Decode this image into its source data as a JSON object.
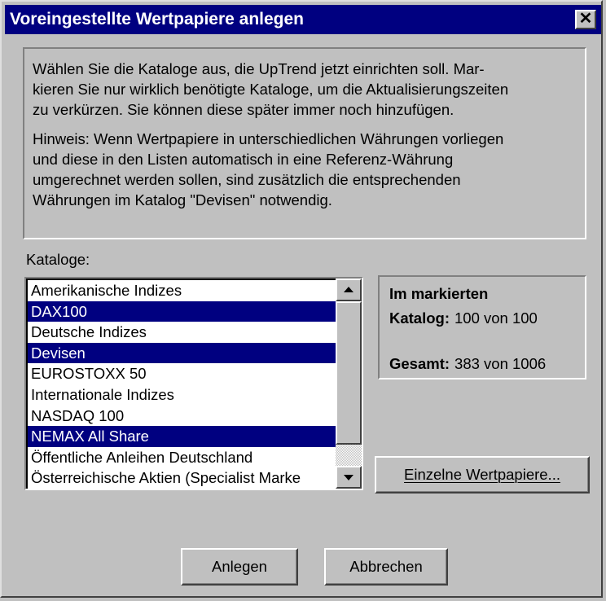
{
  "window": {
    "title": "Voreingestellte Wertpapiere anlegen",
    "close_glyph": "✕"
  },
  "info": {
    "paragraph1": "Wählen Sie die Kataloge aus, die UpTrend jetzt einrichten soll. Markieren Sie nur wirklich benötigte Kataloge, um die Aktualisierungszeiten zu verkürzen. Sie können diese später immer noch hinzufügen.",
    "paragraph1_lines": [
      "Wählen Sie die Kataloge aus, die UpTrend jetzt einrichten soll. Mar-",
      "kieren Sie nur wirklich benötigte Kataloge, um die Aktualisierungszeiten",
      "zu verkürzen. Sie können diese später immer noch hinzufügen."
    ],
    "paragraph2_lines": [
      "Hinweis: Wenn Wertpapiere in unterschiedlichen Währungen vorliegen",
      "und diese in den Listen automatisch in eine Referenz-Währung",
      "umgerechnet werden sollen, sind zusätzlich die entsprechenden",
      "Währungen im Katalog \"Devisen\" notwendig."
    ]
  },
  "catalogs": {
    "label": "Kataloge:",
    "items": [
      {
        "label": "Amerikanische Indizes",
        "selected": false
      },
      {
        "label": "DAX100",
        "selected": true
      },
      {
        "label": "Deutsche Indizes",
        "selected": false
      },
      {
        "label": "Devisen",
        "selected": true
      },
      {
        "label": "EUROSTOXX 50",
        "selected": false
      },
      {
        "label": "Internationale Indizes",
        "selected": false
      },
      {
        "label": "NASDAQ 100",
        "selected": false
      },
      {
        "label": "NEMAX All Share",
        "selected": true
      },
      {
        "label": "Öffentliche Anleihen Deutschland",
        "selected": false
      },
      {
        "label": "Österreichische Aktien (Specialist Marke",
        "selected": false
      }
    ]
  },
  "stats": {
    "heading": "Im markierten",
    "katalog_label": "Katalog:",
    "katalog_value": "100 von 100",
    "gesamt_label": "Gesamt:",
    "gesamt_value": "383 von 1006"
  },
  "buttons": {
    "einzelne": "Einzelne Wertpapiere...",
    "anlegen": "Anlegen",
    "abbrechen": "Abbrechen"
  }
}
